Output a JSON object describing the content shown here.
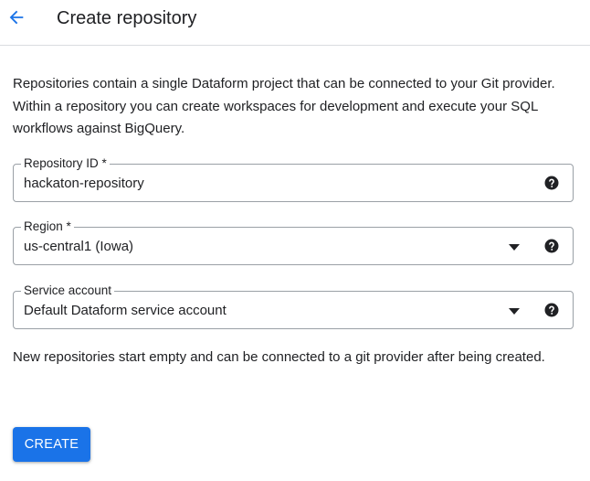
{
  "header": {
    "back_icon": "arrow-back-icon",
    "title": "Create repository"
  },
  "description": "Repositories contain a single Dataform project that can be connected to your Git provider. Within a repository you can create workspaces for development and execute your SQL workflows against BigQuery.",
  "fields": {
    "repository_id": {
      "label": "Repository ID *",
      "value": "hackaton-repository",
      "help_icon": "help-icon"
    },
    "region": {
      "label": "Region *",
      "value": "us-central1 (Iowa)",
      "dropdown_icon": "dropdown-arrow-icon",
      "help_icon": "help-icon"
    },
    "service_account": {
      "label": "Service account",
      "value": "Default Dataform service account",
      "dropdown_icon": "dropdown-arrow-icon",
      "help_icon": "help-icon"
    }
  },
  "note": "New repositories start empty and can be connected to a git provider after being created.",
  "actions": {
    "create_label": "CREATE"
  },
  "colors": {
    "accent": "#1a73e8",
    "border": "#9aa0a6",
    "divider": "#dadce0",
    "text": "#202124"
  }
}
